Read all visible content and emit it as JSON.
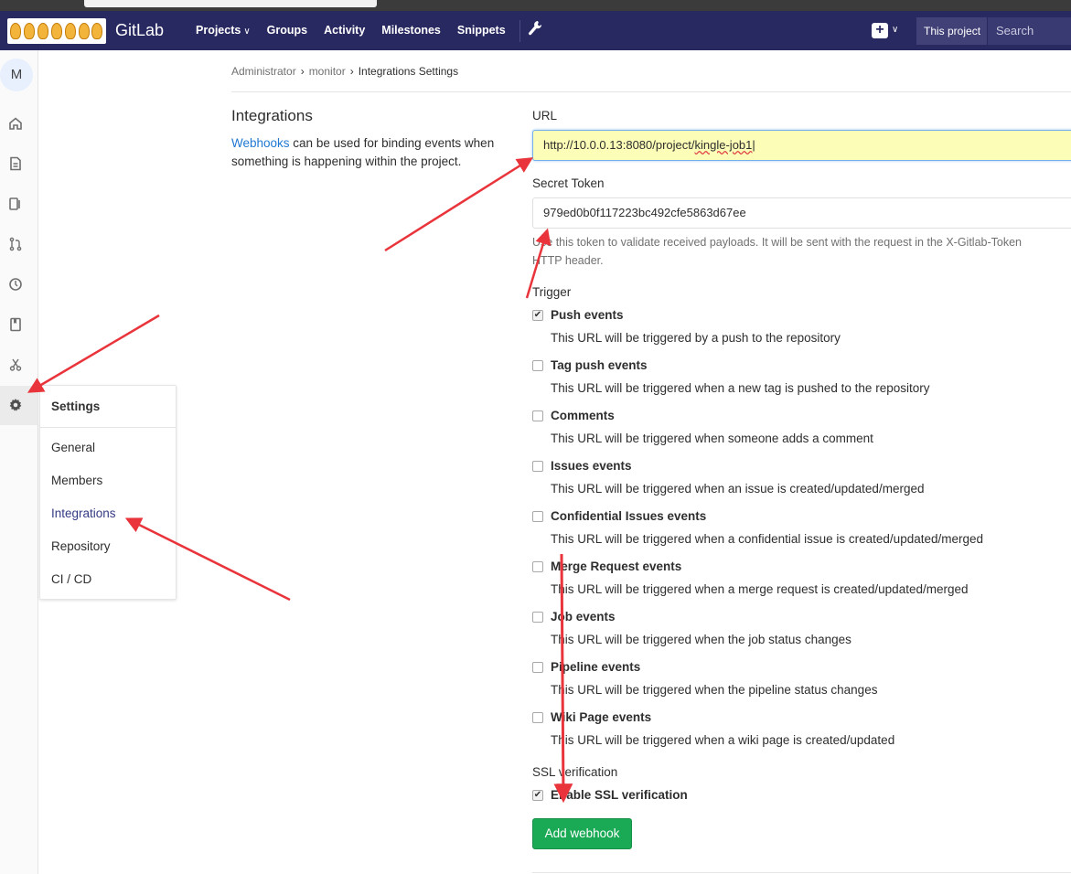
{
  "navbar": {
    "brand": "GitLab",
    "items": [
      {
        "label": "Projects",
        "has_dropdown": true
      },
      {
        "label": "Groups"
      },
      {
        "label": "Activity"
      },
      {
        "label": "Milestones"
      },
      {
        "label": "Snippets"
      }
    ],
    "plus_icon": "+",
    "scope_button": "This project",
    "search_placeholder": "Search"
  },
  "sidebar": {
    "avatar_letter": "M",
    "icons": [
      "home-icon",
      "file-icon",
      "issues-icon",
      "merge-request-icon",
      "pipeline-icon",
      "wiki-icon",
      "snippet-icon",
      "settings-gear-icon"
    ]
  },
  "flyout": {
    "title": "Settings",
    "items": [
      "General",
      "Members",
      "Integrations",
      "Repository",
      "CI / CD"
    ],
    "active_item": "Integrations"
  },
  "breadcrumb": {
    "items": [
      "Administrator",
      "monitor",
      "Integrations Settings"
    ]
  },
  "section": {
    "title": "Integrations",
    "desc_link": "Webhooks",
    "desc_text": " can be used for binding events when something is happening within the project."
  },
  "form": {
    "url_label": "URL",
    "url_prefix": "http://10.0.0.13:8080/project/",
    "url_suffix": "kingle-job1",
    "token_label": "Secret Token",
    "token_value": "979ed0b0f117223bc492cfe5863d67ee",
    "token_help_line1": "Use this token to validate received payloads. It will be sent with the request in the X-Gitlab-Token",
    "token_help_line2": "HTTP header.",
    "trigger_label": "Trigger",
    "triggers": [
      {
        "label": "Push events",
        "desc": "This URL will be triggered by a push to the repository",
        "checked": true
      },
      {
        "label": "Tag push events",
        "desc": "This URL will be triggered when a new tag is pushed to the repository",
        "checked": false
      },
      {
        "label": "Comments",
        "desc": "This URL will be triggered when someone adds a comment",
        "checked": false
      },
      {
        "label": "Issues events",
        "desc": "This URL will be triggered when an issue is created/updated/merged",
        "checked": false
      },
      {
        "label": "Confidential Issues events",
        "desc": "This URL will be triggered when a confidential issue is created/updated/merged",
        "checked": false
      },
      {
        "label": "Merge Request events",
        "desc": "This URL will be triggered when a merge request is created/updated/merged",
        "checked": false
      },
      {
        "label": "Job events",
        "desc": "This URL will be triggered when the job status changes",
        "checked": false
      },
      {
        "label": "Pipeline events",
        "desc": "This URL will be triggered when the pipeline status changes",
        "checked": false
      },
      {
        "label": "Wiki Page events",
        "desc": "This URL will be triggered when a wiki page is created/updated",
        "checked": false
      }
    ],
    "ssl_label": "SSL verification",
    "ssl_checkbox_label": "Enable SSL verification",
    "ssl_checked": true,
    "submit_label": "Add webhook"
  },
  "colors": {
    "navbar": "#292961",
    "accent_link": "#1f78d1",
    "submit": "#1aaa55",
    "annotation_arrow": "#e8343a"
  }
}
